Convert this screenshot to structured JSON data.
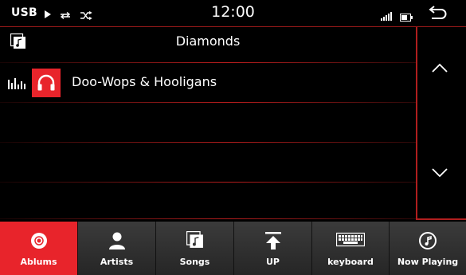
{
  "status_bar": {
    "source": "USB",
    "clock": "12:00",
    "icons": [
      "play-icon",
      "repeat-icon",
      "shuffle-icon",
      "signal-icon",
      "battery-icon",
      "back-icon"
    ]
  },
  "list": {
    "header_title": "Diamonds",
    "header_icon": "music-folder-icon",
    "items": [
      {
        "label": "Doo-Wops & Hooligans",
        "icon": "headphones-icon",
        "playing": true
      }
    ]
  },
  "scroll": {
    "up_icon": "chevron-up-icon",
    "down_icon": "chevron-down-icon"
  },
  "tabs": [
    {
      "label": "Ablums",
      "icon": "disc-icon",
      "active": true
    },
    {
      "label": "Artists",
      "icon": "person-icon",
      "active": false
    },
    {
      "label": "Songs",
      "icon": "music-folder-icon",
      "active": false
    },
    {
      "label": "UP",
      "icon": "up-arrow-icon",
      "active": false
    },
    {
      "label": "keyboard",
      "icon": "keyboard-icon",
      "active": false
    },
    {
      "label": "Now Playing",
      "icon": "now-playing-icon",
      "active": false
    }
  ],
  "colors": {
    "accent": "#e8242b",
    "divider": "#b01e1e",
    "tab_bg": "#303030"
  }
}
